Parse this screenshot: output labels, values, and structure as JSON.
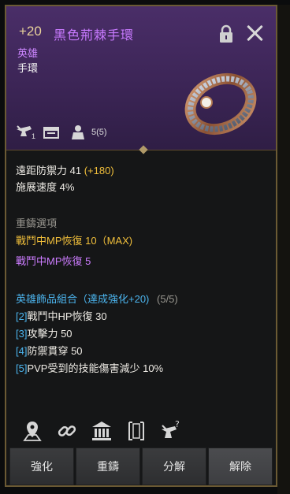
{
  "header": {
    "enhance_level": "+20",
    "item_name": "黑色荊棘手環",
    "grade": "英雄",
    "item_type": "手環",
    "sockets": "5(5)",
    "icon_sub": "1"
  },
  "stats": {
    "defense_label": "遠距防禦力 41",
    "defense_bonus": "(+180)",
    "speed": "施展速度 4%"
  },
  "refine": {
    "title": "重鑄選項",
    "option1": "戰鬥中MP恢復 10（MAX)",
    "option2": "戰鬥中MP恢復 5"
  },
  "set": {
    "title": "英雄飾品組合（達成強化+20)",
    "count": "(5/5)",
    "items": [
      {
        "num": "[2]",
        "text": "戰鬥中HP恢復 30"
      },
      {
        "num": "[3]",
        "text": "攻擊力 50"
      },
      {
        "num": "[4]",
        "text": "防禦貫穿 50"
      },
      {
        "num": "[5]",
        "text": "PVP受到的技能傷害減少 10%"
      }
    ]
  },
  "buttons": {
    "enhance": "強化",
    "reforge": "重鑄",
    "dismantle": "分解",
    "remove": "解除"
  },
  "colors": {
    "header_bg": "#3c2556",
    "item_name": "#c879ff",
    "gold": "#f1bf3b",
    "set_blue": "#4cb5ef"
  }
}
